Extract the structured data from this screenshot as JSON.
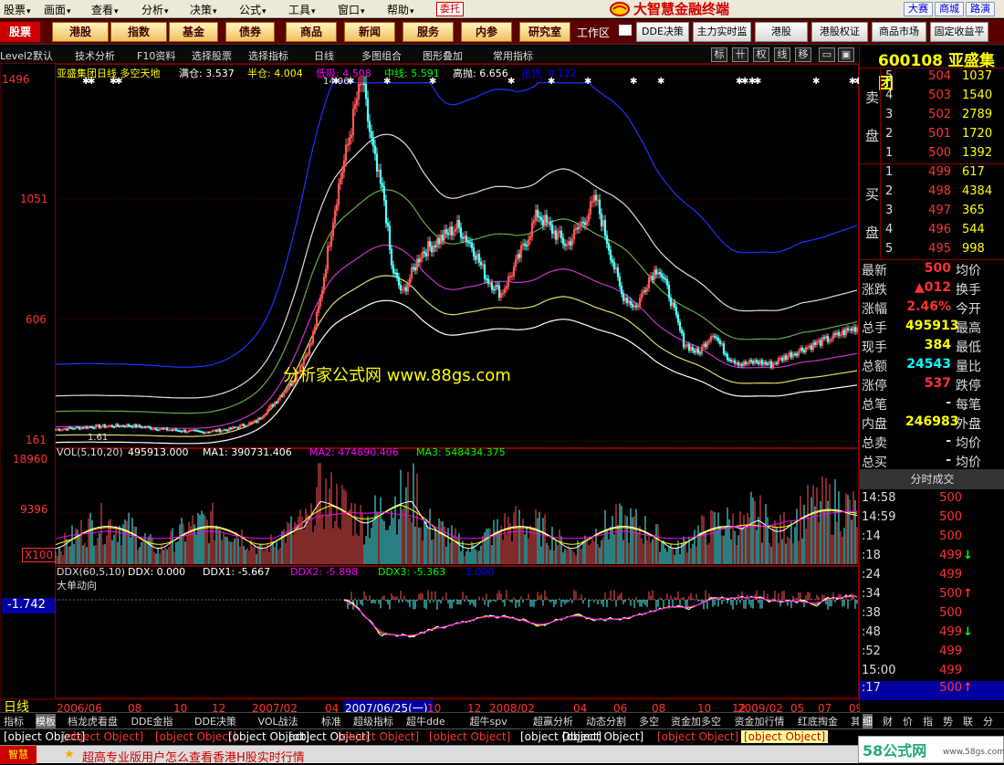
{
  "menu": [
    "股票",
    "画面",
    "查看",
    "分析",
    "决策",
    "公式",
    "工具",
    "窗口",
    "帮助"
  ],
  "menu_extra": "委托",
  "brand": "大智慧金融终端",
  "right_buttons": [
    "大赛",
    "商城",
    "路演"
  ],
  "toolbar": {
    "first": "股票",
    "main": [
      "港股",
      "指数",
      "基金",
      "债券",
      "商品",
      "新闻",
      "服务",
      "内参",
      "研究室"
    ],
    "workspace": "工作区",
    "right": [
      "DDE决策",
      "主力实时监",
      "港股",
      "港股权证",
      "商品市场",
      "固定收益平"
    ]
  },
  "subbar": {
    "items": [
      "Level2默认",
      "技术分析",
      "F10资料",
      "选择股票",
      "选择指标",
      "日线",
      "多图组合",
      "图形叠加",
      "常用指标"
    ],
    "right_btns": [
      "标",
      "卄",
      "权",
      "线",
      "移"
    ]
  },
  "chart_data": [
    {
      "type": "line",
      "name": "price",
      "title": "亚盛集团日线 多空天地",
      "indicators": [
        {
          "label": "满仓: 3.537",
          "color": "#ffffff"
        },
        {
          "label": "半仓: 4.004",
          "color": "#ffff00"
        },
        {
          "label": "低吸: 4.508",
          "color": "#ff00ff"
        },
        {
          "label": "中线: 5.591",
          "color": "#00ff00"
        },
        {
          "label": "高抛: 6.656",
          "color": "#ffffff"
        },
        {
          "label": "出货: 9.122",
          "color": "#0000ff"
        }
      ],
      "y_ticks": [
        "1496",
        "1051",
        "606",
        "161"
      ],
      "high_label": "14.96",
      "low_label": "1.61",
      "x_labels": [
        "2006/06",
        "08",
        "10",
        "12",
        "2007/02",
        "04",
        "06",
        "2007/06/25(一)",
        "10",
        "12",
        "2008/02",
        "04",
        "06",
        "08",
        "10",
        "12",
        "2009/02",
        "05",
        "07",
        "09"
      ]
    },
    {
      "type": "bar",
      "name": "volume",
      "title": "VOL(5,10,20)",
      "readouts": [
        {
          "label": "495913.000",
          "color": "#ffffff"
        },
        {
          "label": "MA1: 390731.406",
          "color": "#ffffff"
        },
        {
          "label": "MA2: 474890.406",
          "color": "#ff00ff"
        },
        {
          "label": "MA3: 548434.375",
          "color": "#00ff00"
        }
      ],
      "y_ticks": [
        "18960",
        "9396"
      ],
      "unit": "X100"
    },
    {
      "type": "line",
      "name": "ddx",
      "title": "DDX(60,5,10)",
      "subtitle": "大单动向",
      "readouts": [
        {
          "label": "DDX: 0.000",
          "color": "#ffffff"
        },
        {
          "label": "DDX1: -5.667",
          "color": "#ffffff"
        },
        {
          "label": "DDX2: -5.898",
          "color": "#ff00ff"
        },
        {
          "label": "DDX3: -5.363",
          "color": "#00ff00"
        },
        {
          "label": "1.000",
          "color": "#0000ff"
        }
      ],
      "cursor_value": "-1.742"
    }
  ],
  "watermark": "分析家公式网 www.88gs.com",
  "stock": {
    "code": "600108",
    "name": "亚盛集团"
  },
  "orderbook": {
    "sell_label": [
      "卖",
      "盘"
    ],
    "buy_label": [
      "买",
      "盘"
    ],
    "sell": [
      {
        "n": "5",
        "p": "504",
        "v": "1037"
      },
      {
        "n": "4",
        "p": "503",
        "v": "1540"
      },
      {
        "n": "3",
        "p": "502",
        "v": "2789"
      },
      {
        "n": "2",
        "p": "501",
        "v": "1720"
      },
      {
        "n": "1",
        "p": "500",
        "v": "1392"
      }
    ],
    "buy": [
      {
        "n": "1",
        "p": "499",
        "v": "617"
      },
      {
        "n": "2",
        "p": "498",
        "v": "4384"
      },
      {
        "n": "3",
        "p": "497",
        "v": "365"
      },
      {
        "n": "4",
        "p": "496",
        "v": "544"
      },
      {
        "n": "5",
        "p": "495",
        "v": "998"
      }
    ]
  },
  "quote": [
    {
      "l1": "最新",
      "v1": "500",
      "c": "#ff3333",
      "l2": "均价"
    },
    {
      "l1": "涨跌",
      "v1": "▲012",
      "c": "#ff3333",
      "l2": "换手"
    },
    {
      "l1": "涨幅",
      "v1": "2.46%",
      "c": "#ff3333",
      "l2": "今开"
    },
    {
      "l1": "总手",
      "v1": "495913",
      "c": "#ffff00",
      "l2": "最高"
    },
    {
      "l1": "现手",
      "v1": "384",
      "c": "#ffff00",
      "l2": "最低"
    },
    {
      "l1": "总额",
      "v1": "24543",
      "c": "#00ffff",
      "l2": "量比"
    },
    {
      "l1": "涨停",
      "v1": "537",
      "c": "#ff3333",
      "l2": "跌停"
    },
    {
      "l1": "总笔",
      "v1": "-",
      "c": "#dddddd",
      "l2": "每笔"
    },
    {
      "l1": "内盘",
      "v1": "246983",
      "c": "#ffff00",
      "l2": "外盘"
    },
    {
      "l1": "总卖",
      "v1": "-",
      "c": "#dddddd",
      "l2": "均价"
    },
    {
      "l1": "总买",
      "v1": "-",
      "c": "#dddddd",
      "l2": "均价"
    }
  ],
  "ticks_title": "分时成交",
  "ticks": [
    {
      "t": "14:58",
      "p": "500",
      "a": ""
    },
    {
      "t": "14:59",
      "p": "500",
      "a": ""
    },
    {
      "t": ":14",
      "p": "500",
      "a": ""
    },
    {
      "t": ":18",
      "p": "499",
      "a": "↓"
    },
    {
      "t": ":24",
      "p": "499",
      "a": ""
    },
    {
      "t": ":34",
      "p": "500",
      "a": "↑"
    },
    {
      "t": ":38",
      "p": "500",
      "a": ""
    },
    {
      "t": ":48",
      "p": "499",
      "a": "↓"
    },
    {
      "t": ":52",
      "p": "499",
      "a": ""
    },
    {
      "t": "15:00",
      "p": "499",
      "a": ""
    },
    {
      "t": ":17",
      "p": "500",
      "a": "↑"
    }
  ],
  "tabs": [
    "指标",
    "模板",
    "档龙虎看盘",
    "DDE金指",
    "DDE决策",
    "VOL战法",
    "标准",
    "超级指标",
    "超牛dde",
    "超牛spv",
    "超赢分析",
    "动态分割",
    "多空",
    "资金加多空",
    "资金加行情",
    "红底掏金",
    "其他"
  ],
  "rtabs": [
    "细",
    "财",
    "价",
    "指",
    "势",
    "联",
    "分"
  ],
  "period": "日线",
  "status": [
    {
      "t": "沪",
      "c": "#ffffff"
    },
    {
      "t": "2861.61",
      "c": "#ff3333"
    },
    {
      "t": "▲16.59",
      "c": "#ff3333"
    },
    {
      "t": "1,459.1亿",
      "c": "#ffffff"
    },
    {
      "t": "深",
      "c": "#ffffff"
    },
    {
      "t": "11519.68",
      "c": "#ff3333"
    },
    {
      "t": "▲115.63",
      "c": "#ff3333"
    },
    {
      "t": "736.6亿",
      "c": "#ffffff"
    },
    {
      "t": "中小板指",
      "c": "#ffffff"
    },
    {
      "t": "4319.18",
      "c": "#ff3333"
    },
    {
      "t": "股票公式股票软件下载",
      "c": "#ffff00"
    }
  ],
  "ticker_left": "智慧",
  "ticker_text": "超高专业版用户怎么查看香港H股实时行情",
  "site_mark": "58公式网",
  "site_url": "www.58gs.com"
}
